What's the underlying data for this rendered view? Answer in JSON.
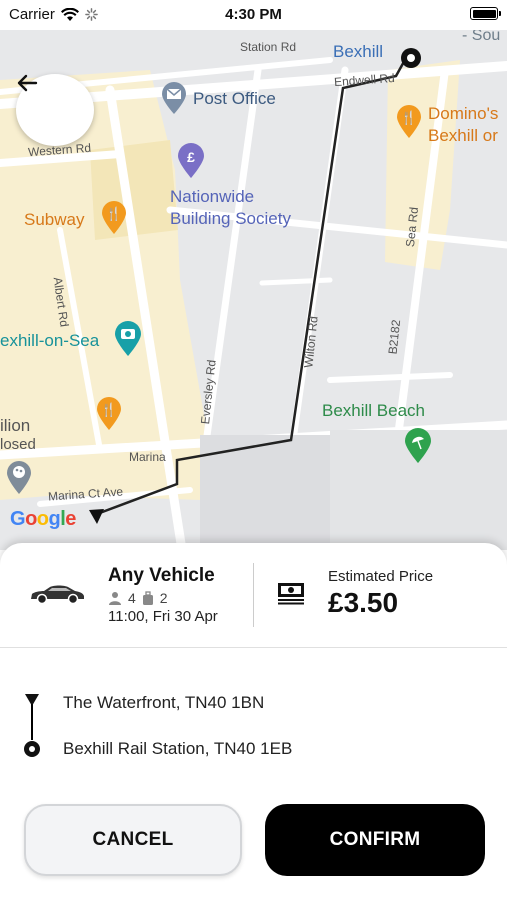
{
  "status_bar": {
    "carrier": "Carrier",
    "time": "4:30 PM"
  },
  "map": {
    "streets": {
      "station_rd": "Station Rd",
      "endwell_rd": "Endwell Rd",
      "western_rd": "Western Rd",
      "sea_rd": "Sea Rd",
      "albert_rd": "Albert Rd",
      "eversley_rd": "Eversley Rd",
      "wilton_rd": "Wilton Rd",
      "b2182": "B2182",
      "marina": "Marina",
      "marina_ct_ave": "Marina Ct Ave",
      "south": "- Sou"
    },
    "pois": {
      "bexhill": "Bexhill",
      "post_office": "Post Office",
      "dominos_1": "Domino's",
      "dominos_2": "Bexhill or",
      "nationwide_1": "Nationwide",
      "nationwide_2": "Building Society",
      "subway": "Subway",
      "bexhill_on_sea": "exhill-on-Sea",
      "bexhill_beach": "Bexhill Beach",
      "pavilion_1": "ilion",
      "pavilion_2": "losed"
    },
    "google": [
      "G",
      "o",
      "o",
      "g",
      "l",
      "e"
    ],
    "google_colors": [
      "#4285F4",
      "#EA4335",
      "#FBBC05",
      "#4285F4",
      "#34A853",
      "#EA4335"
    ]
  },
  "trip": {
    "vehicle": "Any Vehicle",
    "passengers": "4",
    "luggage": "2",
    "datetime": "11:00, Fri 30 Apr",
    "price_label": "Estimated Price",
    "price": "£3.50",
    "pickup": "The Waterfront, TN40 1BN",
    "dropoff": "Bexhill Rail Station, TN40 1EB"
  },
  "actions": {
    "cancel": "CANCEL",
    "confirm": "CONFIRM"
  }
}
